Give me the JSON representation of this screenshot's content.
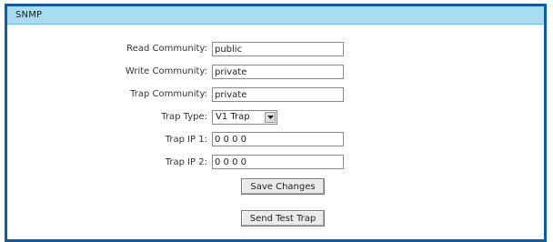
{
  "panel": {
    "title": "SNMP"
  },
  "form": {
    "read_community": {
      "label": "Read Community:",
      "value": "public"
    },
    "write_community": {
      "label": "Write Community:",
      "value": "private"
    },
    "trap_community": {
      "label": "Trap Community:",
      "value": "private"
    },
    "trap_type": {
      "label": "Trap Type:",
      "value": "V1 Trap"
    },
    "trap_ip_1": {
      "label": "Trap IP 1:",
      "value": "0 0 0 0"
    },
    "trap_ip_2": {
      "label": "Trap IP 2:",
      "value": "0 0 0 0"
    }
  },
  "actions": {
    "save_label": "Save Changes",
    "send_test_label": "Send Test Trap"
  },
  "colors": {
    "panel_border": "#0a5ea8",
    "header_bg": "#a9dcf0"
  },
  "icons": {
    "dropdown": "chevron-down-icon"
  }
}
